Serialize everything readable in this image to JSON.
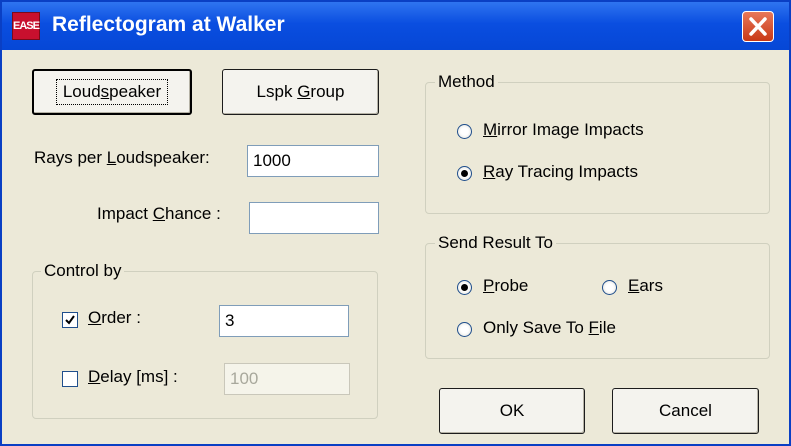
{
  "window": {
    "title": "Reflectogram at Walker",
    "app_icon_text": "EASE",
    "close_icon": "close-x-icon"
  },
  "buttons": {
    "loudspeaker": {
      "pre": "Loud",
      "mnemonic": "s",
      "post": "peaker"
    },
    "lspk_group": {
      "pre": "Lspk ",
      "mnemonic": "G",
      "post": "roup"
    },
    "ok": "OK",
    "cancel": "Cancel"
  },
  "rays": {
    "label_pre": "Rays per ",
    "label_mnemonic": "L",
    "label_post": "oudspeaker:",
    "value": "1000"
  },
  "impact_chance": {
    "label_pre": "Impact ",
    "label_mnemonic": "C",
    "label_post": "hance :",
    "value": ""
  },
  "control_by": {
    "legend": "Control by",
    "order": {
      "checked": true,
      "mnemonic": "O",
      "label_post": "rder :",
      "value": "3"
    },
    "delay": {
      "checked": false,
      "mnemonic": "D",
      "label_post": "elay [ms] :",
      "value": "100"
    }
  },
  "method": {
    "legend": "Method",
    "options": [
      {
        "mnemonic": "M",
        "label_post": "irror Image Impacts",
        "checked": false
      },
      {
        "mnemonic": "R",
        "label_post": "ay Tracing Impacts",
        "checked": true
      }
    ]
  },
  "send_result": {
    "legend": "Send Result To",
    "probe": {
      "mnemonic": "P",
      "label_post": "robe",
      "checked": true
    },
    "ears": {
      "mnemonic": "E",
      "label_post": "ars",
      "checked": false
    },
    "only_save": {
      "label_pre": "Only Save To ",
      "mnemonic": "F",
      "label_post": "ile",
      "checked": false
    }
  },
  "colors": {
    "titlebar": "#0a4ee0",
    "dialog_bg": "#ece9d8",
    "close_button": "#d9482a"
  }
}
